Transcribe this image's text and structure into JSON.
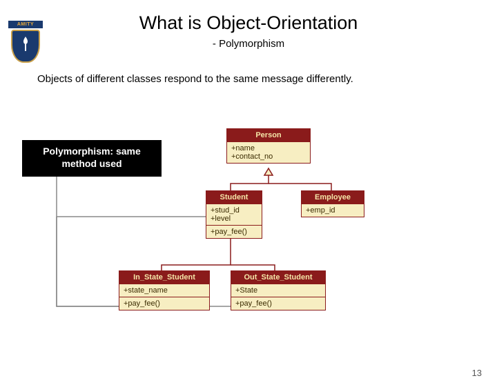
{
  "logo": {
    "text": "AMITY"
  },
  "title": "What is Object-Orientation",
  "subtitle": "- Polymorphism",
  "description": "Objects of different classes respond to the same message differently.",
  "callout": {
    "line1": "Polymorphism: same",
    "line2": "method used"
  },
  "uml": {
    "person": {
      "name": "Person",
      "attrs": [
        "+name",
        "+contact_no"
      ]
    },
    "student": {
      "name": "Student",
      "attrs": [
        "+stud_id",
        "+level"
      ],
      "ops": [
        "+pay_fee()"
      ]
    },
    "employee": {
      "name": "Employee",
      "attrs": [
        "+emp_id"
      ]
    },
    "in_state": {
      "name": "In_State_Student",
      "attrs": [
        "+state_name"
      ],
      "ops": [
        "+pay_fee()"
      ]
    },
    "out_state": {
      "name": "Out_State_Student",
      "attrs": [
        "+State"
      ],
      "ops": [
        "+pay_fee()"
      ]
    }
  },
  "page_number": "13"
}
